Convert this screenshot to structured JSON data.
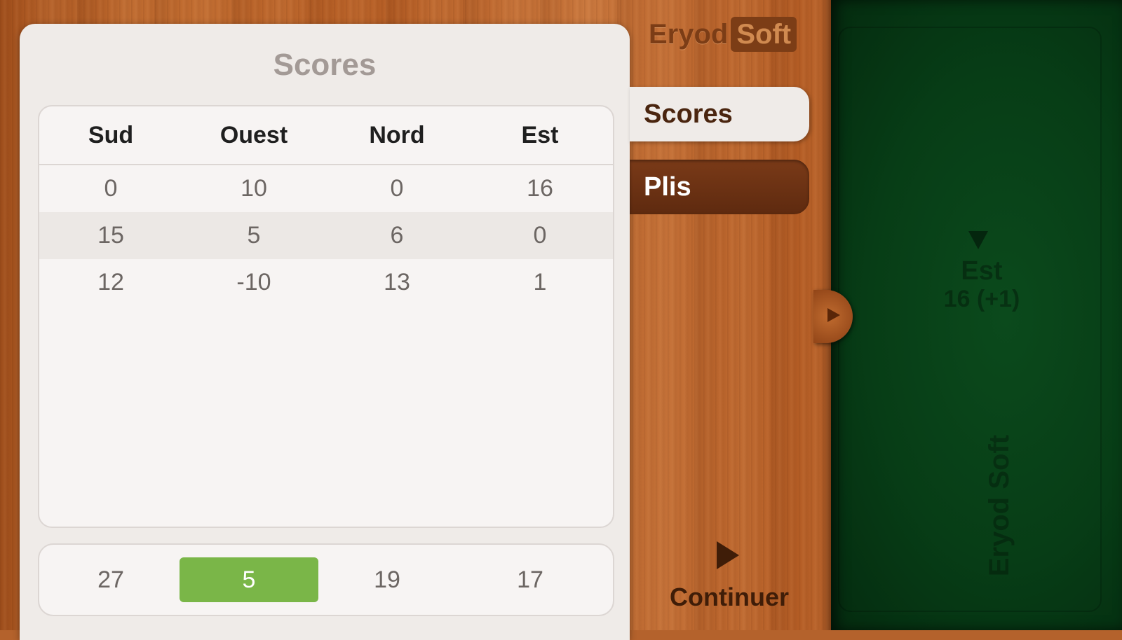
{
  "logo": {
    "part1": "Eryod",
    "part2": "Soft"
  },
  "panel": {
    "title": "Scores"
  },
  "table": {
    "headers": [
      "Sud",
      "Ouest",
      "Nord",
      "Est"
    ],
    "rows": [
      [
        "0",
        "10",
        "0",
        "16"
      ],
      [
        "15",
        "5",
        "6",
        "0"
      ],
      [
        "12",
        "-10",
        "13",
        "1"
      ]
    ],
    "totals": [
      "27",
      "5",
      "19",
      "17"
    ],
    "highlight_color": "#7ab648"
  },
  "tabs": [
    {
      "label": "Scores",
      "active": true
    },
    {
      "label": "Plis",
      "active": false
    }
  ],
  "continue": {
    "label": "Continuer",
    "icon": "play-icon"
  },
  "table_view": {
    "player": "Est",
    "score": "16 (+1)",
    "brand": "Eryod Soft"
  },
  "colors": {
    "wood": "#b4622c",
    "felt": "#073d16",
    "panel": "#efebe8"
  }
}
